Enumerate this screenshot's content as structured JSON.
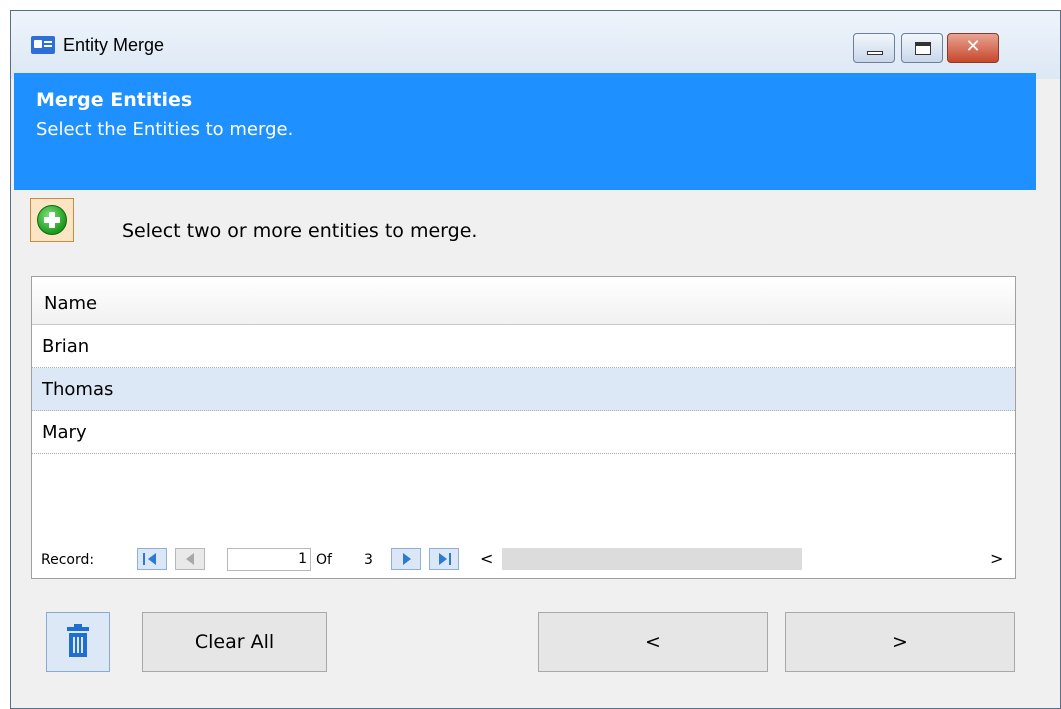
{
  "window": {
    "title": "Entity Merge",
    "icon": "contact-card-icon"
  },
  "header": {
    "title": "Merge Entities",
    "subtitle": "Select the Entities to merge."
  },
  "toolbar": {
    "add_icon": "add-circle-icon",
    "instruction": "Select two or more entities to merge."
  },
  "grid": {
    "column": "Name",
    "rows": [
      "Brian",
      "Thomas",
      "Mary"
    ],
    "selected_row": "Thomas"
  },
  "navigation": {
    "record_label": "Record:",
    "current": "1",
    "of_label": "Of",
    "total": "3"
  },
  "buttons": {
    "delete_icon": "trash-icon",
    "clear_all": "Clear All",
    "back": "<",
    "forward": ">"
  },
  "colors": {
    "header": "#1e90ff",
    "selection": "#dde8f6",
    "accent": "#2a7ad6"
  }
}
